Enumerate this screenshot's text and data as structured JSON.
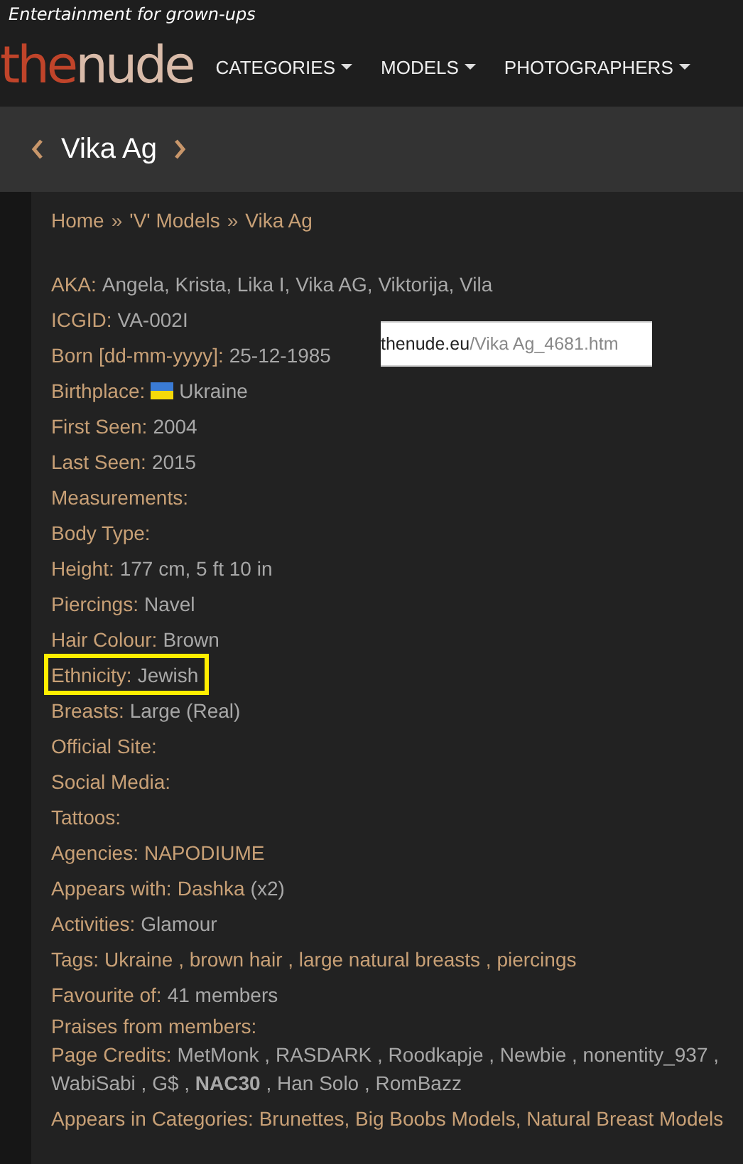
{
  "tagline": "Entertainment for grown-ups",
  "logo": {
    "first": "the",
    "second": "nude"
  },
  "nav": [
    {
      "label": "CATEGORIES"
    },
    {
      "label": "MODELS"
    },
    {
      "label": "PHOTOGRAPHERS"
    }
  ],
  "title": "Vika Ag",
  "breadcrumb": [
    {
      "text": "Home"
    },
    {
      "text": "»",
      "kind": "sep"
    },
    {
      "text": "'V' Models"
    },
    {
      "text": "»",
      "kind": "sep"
    },
    {
      "text": "Vika Ag"
    }
  ],
  "url_overlay": {
    "domain": "thenude.eu",
    "path": "/Vika Ag_4681.htm"
  },
  "fields": [
    {
      "label": "AKA:",
      "highlighted": false,
      "parts": [
        {
          "text": "Angela, Krista, Lika I, Vika AG, Viktorija, Vila",
          "kind": "text"
        }
      ]
    },
    {
      "label": "ICGID:",
      "highlighted": false,
      "parts": [
        {
          "text": "VA-002I",
          "kind": "text"
        }
      ]
    },
    {
      "label": "Born [dd-mm-yyyy]:",
      "highlighted": false,
      "parts": [
        {
          "text": "25-12-1985",
          "kind": "text"
        }
      ]
    },
    {
      "label": "Birthplace:",
      "highlighted": false,
      "parts": [
        {
          "kind": "flag"
        },
        {
          "text": "Ukraine",
          "kind": "text"
        }
      ]
    },
    {
      "label": "First Seen:",
      "highlighted": false,
      "parts": [
        {
          "text": "2004",
          "kind": "text"
        }
      ]
    },
    {
      "label": "Last Seen:",
      "highlighted": false,
      "parts": [
        {
          "text": "2015",
          "kind": "text"
        }
      ]
    },
    {
      "label": "Measurements:",
      "highlighted": false
    },
    {
      "label": "Body Type:",
      "highlighted": false
    },
    {
      "label": "Height:",
      "highlighted": false,
      "parts": [
        {
          "text": "177 cm, 5 ft 10 in",
          "kind": "text"
        }
      ]
    },
    {
      "label": "Piercings:",
      "highlighted": false,
      "parts": [
        {
          "text": "Navel",
          "kind": "text"
        }
      ]
    },
    {
      "label": "Hair Colour:",
      "highlighted": false,
      "parts": [
        {
          "text": "Brown",
          "kind": "text"
        }
      ]
    },
    {
      "label": "Ethnicity:",
      "highlighted": true,
      "parts": [
        {
          "text": "Jewish",
          "kind": "text"
        }
      ]
    },
    {
      "label": "Breasts:",
      "highlighted": false,
      "parts": [
        {
          "text": "Large (Real)",
          "kind": "text"
        }
      ]
    },
    {
      "label": "Official Site:",
      "highlighted": false
    },
    {
      "label": "Social Media:",
      "highlighted": false
    },
    {
      "label": "Tattoos:",
      "highlighted": false
    },
    {
      "label": "Agencies:",
      "highlighted": false,
      "parts": [
        {
          "text": "NAPODIUME",
          "kind": "link"
        }
      ]
    },
    {
      "label": "Appears with:",
      "highlighted": false,
      "parts": [
        {
          "text": "Dashka",
          "kind": "link"
        },
        {
          "text": "(x2)",
          "kind": "text"
        }
      ]
    },
    {
      "label": "Activities:",
      "highlighted": false,
      "parts": [
        {
          "text": "Glamour",
          "kind": "text"
        }
      ]
    },
    {
      "label": "Tags:",
      "highlighted": false,
      "parts": [
        {
          "text": "Ukraine , brown hair , large natural breasts , piercings",
          "kind": "link"
        }
      ]
    },
    {
      "label": "Favourite of:",
      "highlighted": false,
      "parts": [
        {
          "text": "41 members",
          "kind": "text"
        }
      ]
    }
  ],
  "praises": {
    "label": "Praises from members:"
  },
  "credits": {
    "label": "Page Credits:",
    "names": "MetMonk , RASDARK , Roodkapje , Newbie , nonentity_937 , WabiSabi , G$ , **NAC30** , Han Solo , RomBazz"
  },
  "categories": {
    "label": "Appears in Categories:",
    "value": "Brunettes, Big Boobs Models, Natural Breast Models"
  }
}
